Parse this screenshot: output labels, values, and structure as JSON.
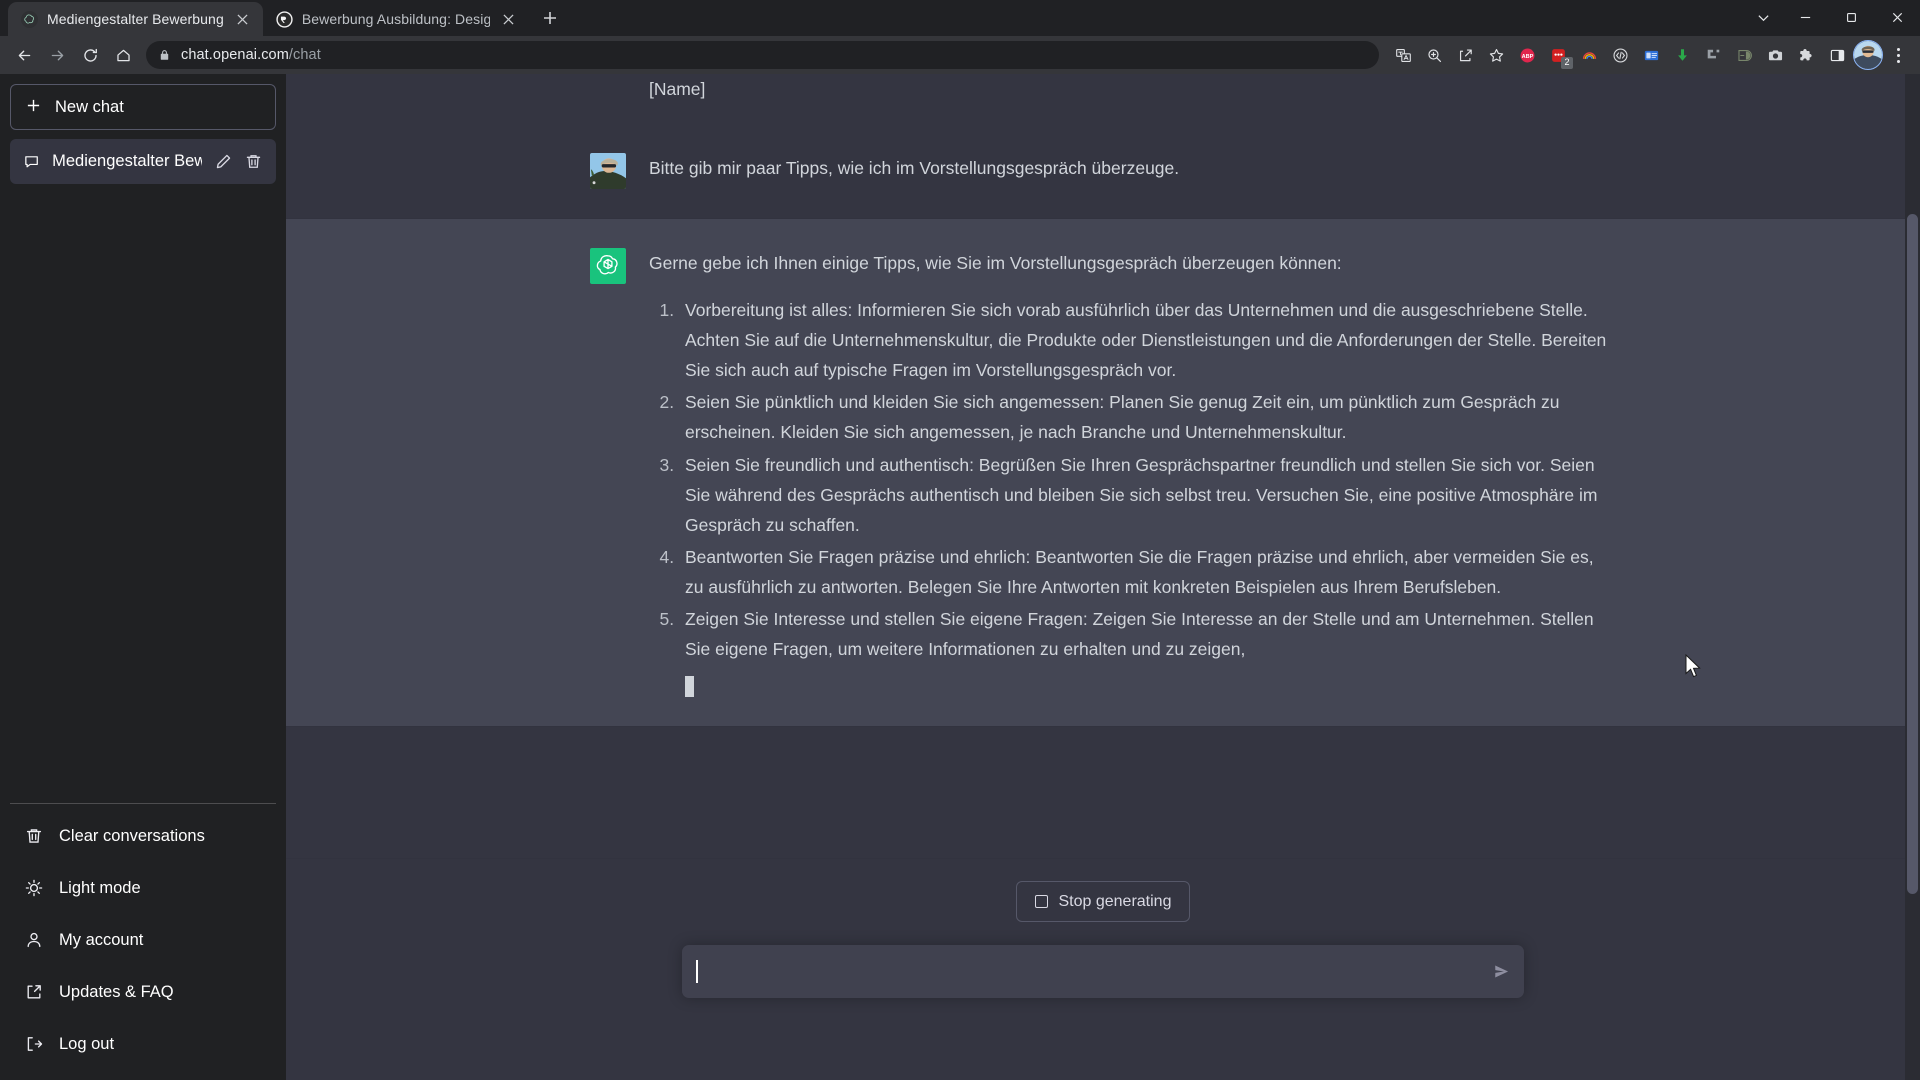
{
  "browser": {
    "tabs": [
      {
        "title": "Mediengestalter Bewerbung",
        "favicon": "openai-icon",
        "active": true
      },
      {
        "title": "Bewerbung Ausbildung: Design-",
        "favicon": "generic-site-icon",
        "active": false
      }
    ],
    "new_tab_label": "+",
    "window_controls": [
      "tab-search-icon",
      "minimize-icon",
      "maximize-icon",
      "close-icon"
    ],
    "nav": {
      "back": "back-icon",
      "forward": "forward-icon",
      "reload": "reload-icon",
      "home": "home-icon"
    },
    "omnibox": {
      "lock": "lock-icon",
      "host": "chat.openai.com",
      "path": "/chat"
    },
    "toolbar_icons": [
      "translate-icon",
      "zoom-icon",
      "share-icon",
      "bookmark-star-icon",
      "adblock-plus-icon",
      "extension-red-dots-icon",
      "rainbow-extension-icon",
      "code-extension-icon",
      "blue-card-extension-icon",
      "download-arrow-icon",
      "pocket-extension-icon",
      "dark-reader-icon",
      "screenshot-camera-icon",
      "extensions-puzzle-icon",
      "sidepanel-icon",
      "profile-avatar-icon",
      "chrome-menu-icon"
    ],
    "extension_badge": "2"
  },
  "sidebar": {
    "new_chat": {
      "label": "New chat",
      "icon": "plus-icon"
    },
    "conversations": [
      {
        "title": "Mediengestalter Bewer",
        "icon": "message-icon",
        "edit": "pencil-icon",
        "delete": "trash-icon",
        "active": true
      }
    ],
    "menu": [
      {
        "label": "Clear conversations",
        "icon": "trash-icon"
      },
      {
        "label": "Light mode",
        "icon": "sun-icon"
      },
      {
        "label": "My account",
        "icon": "person-icon"
      },
      {
        "label": "Updates & FAQ",
        "icon": "external-link-icon"
      },
      {
        "label": "Log out",
        "icon": "logout-icon"
      }
    ]
  },
  "chat": {
    "previous_fragment": "[Name]",
    "user_message": {
      "avatar": "user-photo-avatar",
      "text": "Bitte gib mir paar Tipps, wie ich im Vorstellungsgespräch überzeuge."
    },
    "assistant_message": {
      "avatar": "openai-logo-avatar",
      "intro": "Gerne gebe ich Ihnen einige Tipps, wie Sie im Vorstellungsgespräch überzeugen können:",
      "items": [
        "Vorbereitung ist alles: Informieren Sie sich vorab ausführlich über das Unternehmen und die ausgeschriebene Stelle. Achten Sie auf die Unternehmenskultur, die Produkte oder Dienstleistungen und die Anforderungen der Stelle. Bereiten Sie sich auch auf typische Fragen im Vorstellungsgespräch vor.",
        "Seien Sie pünktlich und kleiden Sie sich angemessen: Planen Sie genug Zeit ein, um pünktlich zum Gespräch zu erscheinen. Kleiden Sie sich angemessen, je nach Branche und Unternehmenskultur.",
        "Seien Sie freundlich und authentisch: Begrüßen Sie Ihren Gesprächspartner freundlich und stellen Sie sich vor. Seien Sie während des Gesprächs authentisch und bleiben Sie sich selbst treu. Versuchen Sie, eine positive Atmosphäre im Gespräch zu schaffen.",
        "Beantworten Sie Fragen präzise und ehrlich: Beantworten Sie die Fragen präzise und ehrlich, aber vermeiden Sie es, zu ausführlich zu antworten. Belegen Sie Ihre Antworten mit konkreten Beispielen aus Ihrem Berufsleben.",
        "Zeigen Sie Interesse und stellen Sie eigene Fragen: Zeigen Sie Interesse an der Stelle und am Unternehmen. Stellen Sie eigene Fragen, um weitere Informationen zu erhalten und zu zeigen,"
      ],
      "streaming": true
    }
  },
  "composer": {
    "stop_button": {
      "label": "Stop generating",
      "icon": "stop-square-icon"
    },
    "input_value": "",
    "input_placeholder": "",
    "send_icon": "send-icon"
  },
  "colors": {
    "sidebar_bg": "#202123",
    "user_msg_bg": "#343541",
    "assistant_msg_bg": "#444654",
    "accent_green": "#19c37d",
    "input_bg": "#40414f",
    "text": "#d1d5db",
    "browser_chrome": "#35363a",
    "tabstrip": "#202124"
  }
}
